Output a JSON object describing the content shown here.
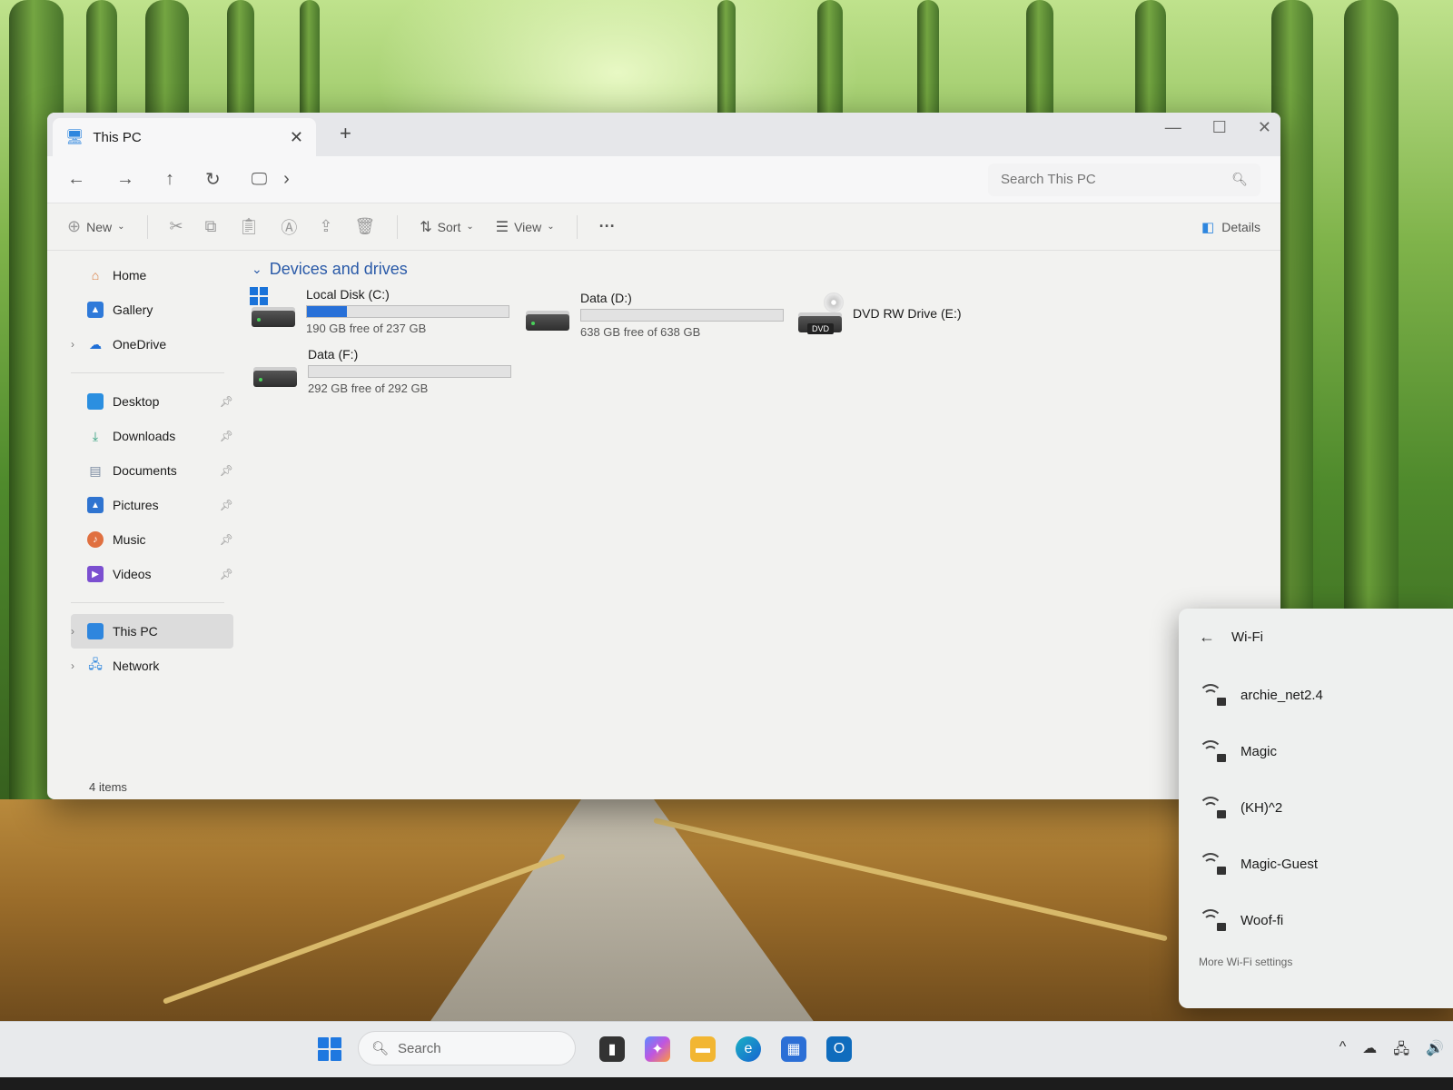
{
  "explorer": {
    "tab_title": "This PC",
    "tab_close": "✕",
    "tab_new": "+",
    "window_controls": {
      "minimize": "—",
      "maximize": "☐",
      "close": "✕"
    },
    "nav": {
      "back": "←",
      "forward": "→",
      "up": "↑",
      "refresh": "↻",
      "location_icon": "monitor-icon",
      "breadcrumb_chevron": "›",
      "search_placeholder": "Search This PC"
    },
    "toolbar": {
      "new_label": "New",
      "sort_label": "Sort",
      "view_label": "View",
      "more_label": "···",
      "details_label": "Details"
    },
    "sidebar": {
      "quick": [
        {
          "label": "Home",
          "icon": "home-icon",
          "color": "#d9793a"
        },
        {
          "label": "Gallery",
          "icon": "gallery-icon",
          "color": "#2f7ad9"
        },
        {
          "label": "OneDrive",
          "icon": "cloud-icon",
          "color": "#1f6fd6",
          "expandable": true
        }
      ],
      "pinned": [
        {
          "label": "Desktop",
          "icon": "desktop-icon",
          "color": "#2b8fe0"
        },
        {
          "label": "Downloads",
          "icon": "download-icon",
          "color": "#2a9d7a"
        },
        {
          "label": "Documents",
          "icon": "document-icon",
          "color": "#7a8aa0"
        },
        {
          "label": "Pictures",
          "icon": "picture-icon",
          "color": "#2f74d0"
        },
        {
          "label": "Music",
          "icon": "music-icon",
          "color": "#e07040"
        },
        {
          "label": "Videos",
          "icon": "video-icon",
          "color": "#7b4fd0"
        }
      ],
      "locations": [
        {
          "label": "This PC",
          "icon": "monitor-icon",
          "color": "#2e86de",
          "selected": true
        },
        {
          "label": "Network",
          "icon": "network-icon",
          "color": "#2e86de"
        }
      ],
      "status": "4 items"
    },
    "content": {
      "group_title": "Devices and drives",
      "drives": [
        {
          "name": "Local Disk (C:)",
          "free": "190 GB free of 237 GB",
          "used_fraction": 0.2,
          "type": "system"
        },
        {
          "name": "Data (D:)",
          "free": "638 GB free of 638 GB",
          "used_fraction": 0.0,
          "type": "disk"
        },
        {
          "name": "DVD RW Drive (E:)",
          "type": "dvd",
          "badge": "DVD"
        },
        {
          "name": "Data (F:)",
          "free": "292 GB free of 292 GB",
          "used_fraction": 0.0,
          "type": "disk"
        }
      ]
    }
  },
  "wifi": {
    "back": "←",
    "title": "Wi-Fi",
    "networks": [
      "archie_net2.4",
      "Magic",
      "(KH)^2",
      "Magic-Guest",
      "Woof-fi"
    ],
    "more_settings": "More Wi-Fi settings"
  },
  "taskbar": {
    "search_placeholder": "Search",
    "apps": [
      "task-view-icon",
      "copilot-icon",
      "file-explorer-icon",
      "edge-icon",
      "store-icon",
      "outlook-icon"
    ],
    "tray": {
      "chevron": "^",
      "cloud": "☁",
      "network": "🖧",
      "volume": "🔊"
    }
  }
}
